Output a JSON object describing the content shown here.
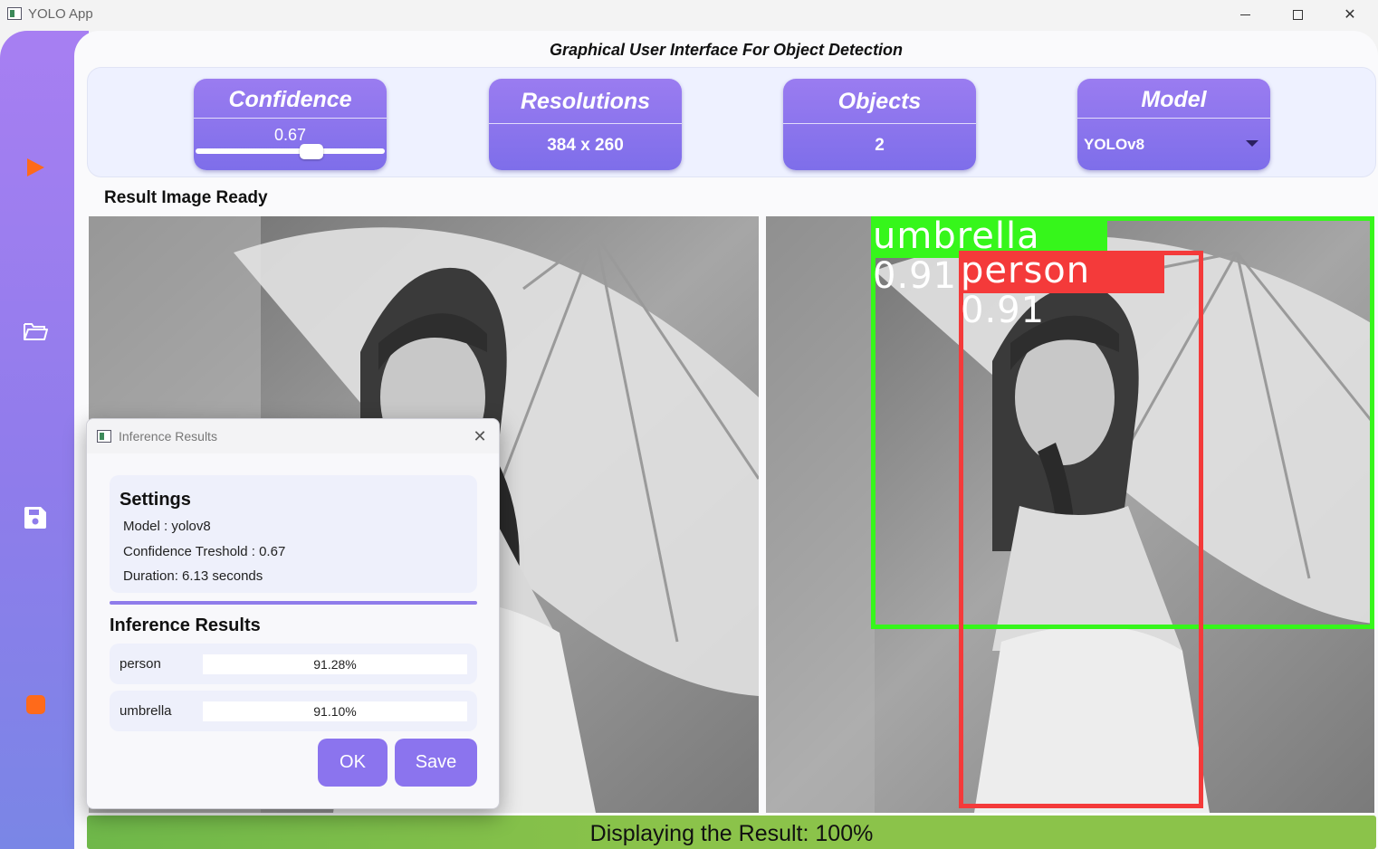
{
  "window": {
    "title": "YOLO App",
    "minimize_icon": "minimize-icon",
    "maximize_icon": "maximize-icon",
    "close_icon": "close-icon"
  },
  "sidebar": {
    "items": [
      {
        "name": "play",
        "icon": "play-icon",
        "color": "#ff6a1a"
      },
      {
        "name": "open-folder",
        "icon": "folder-icon",
        "color": "#ffffff"
      },
      {
        "name": "save",
        "icon": "save-icon",
        "color": "#ffffff"
      },
      {
        "name": "stop",
        "icon": "stop-icon",
        "color": "#ff6a1a"
      }
    ]
  },
  "header": {
    "title": "Graphical User Interface For Object Detection"
  },
  "cards": {
    "confidence": {
      "label": "Confidence",
      "value": "0.67",
      "slider_fraction": 0.67
    },
    "resolutions": {
      "label": "Resolutions",
      "value": "384 x 260"
    },
    "objects": {
      "label": "Objects",
      "value": "2"
    },
    "model": {
      "label": "Model",
      "selected": "YOLOv8"
    }
  },
  "result_label": "Result Image Ready",
  "detections": [
    {
      "label": "umbrella",
      "score_text": "umbrella 0.91",
      "color": "#36f61b"
    },
    {
      "label": "person",
      "score_text": "person 0.91",
      "color": "#f43a3a"
    }
  ],
  "status": {
    "text": "Displaying the Result: 100%",
    "progress": 1.0,
    "color": "#8bc34a"
  },
  "dialog": {
    "title": "Inference Results",
    "settings_title": "Settings",
    "model_line": "Model :  yolov8",
    "confidence_line": "Confidence Treshold :  0.67",
    "duration_line": "Duration:  6.13  seconds",
    "results_title": "Inference Results",
    "results": [
      {
        "name": "person",
        "percent": "91.28%"
      },
      {
        "name": "umbrella",
        "percent": "91.10%"
      }
    ],
    "ok_label": "OK",
    "save_label": "Save",
    "accent_color": "#8b74ee"
  }
}
